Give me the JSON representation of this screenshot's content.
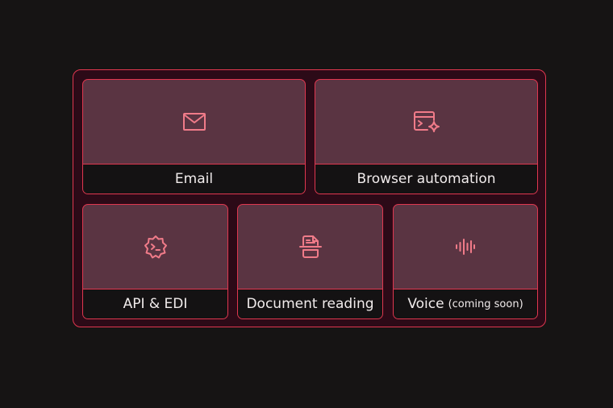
{
  "cards": [
    {
      "id": "email",
      "label": "Email",
      "note": "",
      "icon": "envelope-icon"
    },
    {
      "id": "browser",
      "label": "Browser automation",
      "note": "",
      "icon": "browser-sparkle-icon"
    },
    {
      "id": "api",
      "label": "API & EDI",
      "note": "",
      "icon": "gear-terminal-icon"
    },
    {
      "id": "document",
      "label": "Document reading",
      "note": "",
      "icon": "document-scan-icon"
    },
    {
      "id": "voice",
      "label": "Voice",
      "note": "(coming soon)",
      "icon": "sound-wave-icon"
    }
  ],
  "colors": {
    "accent": "#e0374f",
    "icon": "#f07b89",
    "card_bg": "#5a3442",
    "label_bg": "#141213",
    "frame_bg": "#2c0a17",
    "page_bg": "#161414"
  }
}
